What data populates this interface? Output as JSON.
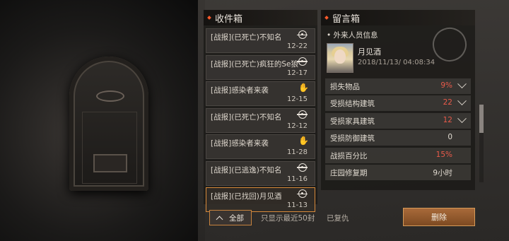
{
  "inbox": {
    "title": "收件箱",
    "items": [
      {
        "title": "[战报](已死亡)不知名",
        "date": "12-22",
        "icon": "crosshair-icon"
      },
      {
        "title": "[战报](已死亡)疯狂的Se狼",
        "date": "12-17",
        "icon": "crosshair-icon"
      },
      {
        "title": "[战报]感染者来袭",
        "date": "12-15",
        "icon": "red-hand-icon"
      },
      {
        "title": "[战报](已死亡)不知名",
        "date": "12-12",
        "icon": "crosshair-icon"
      },
      {
        "title": "[战报]感染者来袭",
        "date": "11-28",
        "icon": "red-hand-icon"
      },
      {
        "title": "[战报](已逃逸)不知名",
        "date": "11-16",
        "icon": "crosshair-icon"
      },
      {
        "title": "[战报](已找回)月见酒",
        "date": "11-13",
        "icon": "crosshair-icon",
        "selected": true
      }
    ]
  },
  "message": {
    "title": "留言箱",
    "section_label": "外来人员信息",
    "sender": {
      "name": "月见酒",
      "time": "2018/11/13/ 04:08:34"
    },
    "rows": [
      {
        "label": "损失物品",
        "value": "9%",
        "red": true,
        "expand": true
      },
      {
        "label": "受损结构建筑",
        "value": "22",
        "red": true,
        "expand": true
      },
      {
        "label": "受损家具建筑",
        "value": "12",
        "red": true,
        "expand": true
      },
      {
        "label": "受损防御建筑",
        "value": "0",
        "red": false,
        "expand": false
      },
      {
        "label": "战损百分比",
        "value": "15%",
        "red": true,
        "expand": false
      },
      {
        "label": "庄园修复期",
        "value": "9小时",
        "red": false,
        "expand": false
      }
    ]
  },
  "bottom": {
    "all_label": "全部",
    "hint": "只显示最近50封",
    "status": "已复仇",
    "delete_label": "删除"
  },
  "colors": {
    "accent": "#d88a3a",
    "alert": "#e85a4a",
    "title_dot": "#ff5a2a"
  }
}
